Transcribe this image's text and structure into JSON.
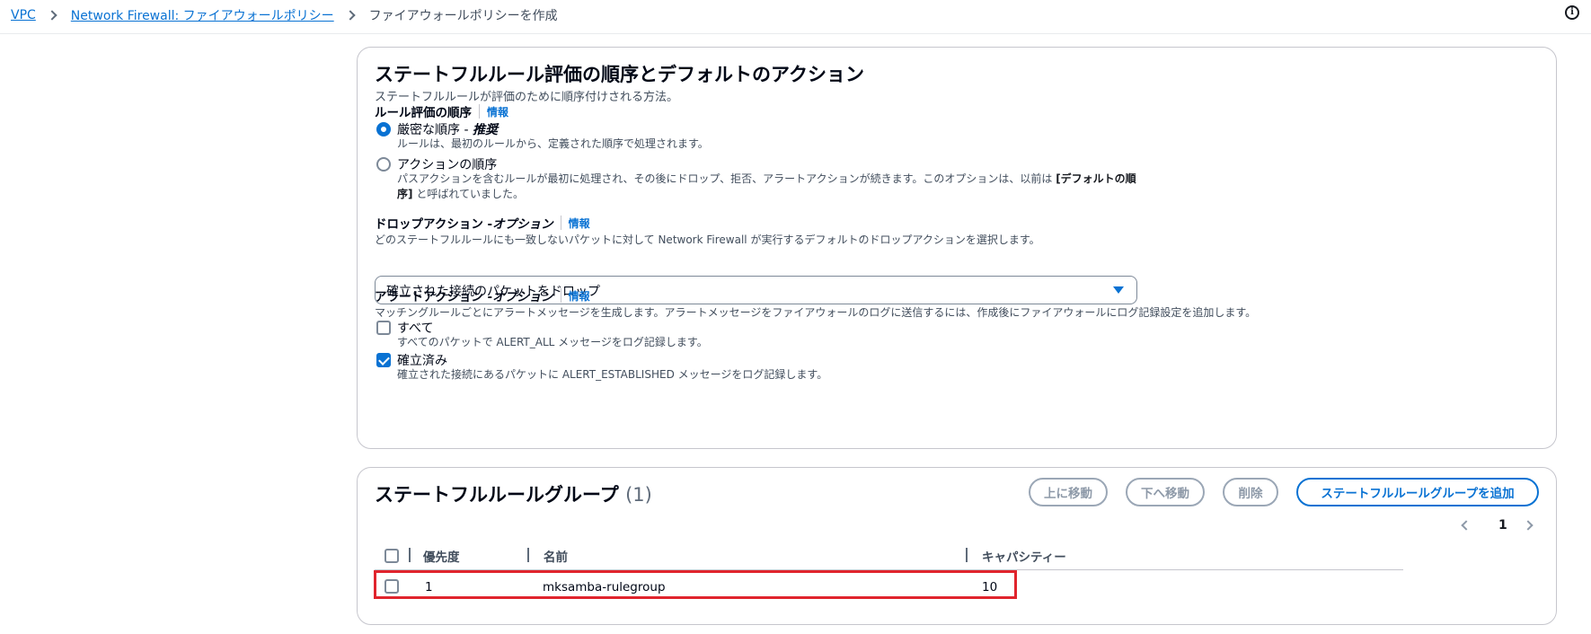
{
  "breadcrumb": {
    "items": [
      "VPC",
      "Network Firewall: ファイアウォールポリシー"
    ],
    "current": "ファイアウォールポリシーを作成"
  },
  "icons": {
    "info": "info-circle-icon",
    "caret": "caret-down-icon",
    "checkmark": "check-icon",
    "chevron_left": "chevron-left-icon",
    "chevron_right": "chevron-right-icon"
  },
  "order_panel": {
    "title": "ステートフルルール評価の順序とデフォルトのアクション",
    "subtitle": "ステートフルルールが評価のために順序付けされる方法。",
    "rule_order": {
      "label": "ルール評価の順序",
      "info": "情報",
      "options": [
        {
          "title": "厳密な順序 - ",
          "title_em": "推奨",
          "desc": "ルールは、最初のルールから、定義された順序で処理されます。",
          "checked": true
        },
        {
          "title": "アクションの順序",
          "desc_pre": "パスアクションを含むルールが最初に処理され、その後にドロップ、拒否、アラートアクションが続きます。このオプションは、以前は ",
          "desc_bold": "[デフォルトの順序]",
          "desc_post": " と呼ばれていました。",
          "checked": false
        }
      ]
    },
    "drop_action": {
      "label": "ドロップアクション - ",
      "label_em": "オプション",
      "info": "情報",
      "desc": "どのステートフルルールにも一致しないパケットに対して Network Firewall が実行するデフォルトのドロップアクションを選択します。",
      "selected": "確立された接続のパケットをドロップ"
    },
    "alert_action": {
      "label": "アラートアクション - ",
      "label_em": "オプション",
      "info": "情報",
      "desc": "マッチングルールごとにアラートメッセージを生成します。アラートメッセージをファイアウォールのログに送信するには、作成後にファイアウォールにログ記録設定を追加します。",
      "options": [
        {
          "title": "すべて",
          "desc": "すべてのパケットで ALERT_ALL メッセージをログ記録します。",
          "checked": false
        },
        {
          "title": "確立済み",
          "desc": "確立された接続にあるパケットに ALERT_ESTABLISHED メッセージをログ記録します。",
          "checked": true
        }
      ]
    }
  },
  "groups_panel": {
    "title": "ステートフルルールグループ",
    "count": "(1)",
    "buttons": {
      "move_up": "上に移動",
      "move_down": "下へ移動",
      "delete": "削除",
      "add": "ステートフルルールグループを追加"
    },
    "page": "1",
    "columns": [
      "優先度",
      "名前",
      "キャパシティー"
    ],
    "rows": [
      {
        "priority": "1",
        "name": "mksamba-rulegroup",
        "capacity": "10"
      }
    ]
  },
  "colors": {
    "accent": "#0972d3",
    "highlight": "#e0242d"
  }
}
